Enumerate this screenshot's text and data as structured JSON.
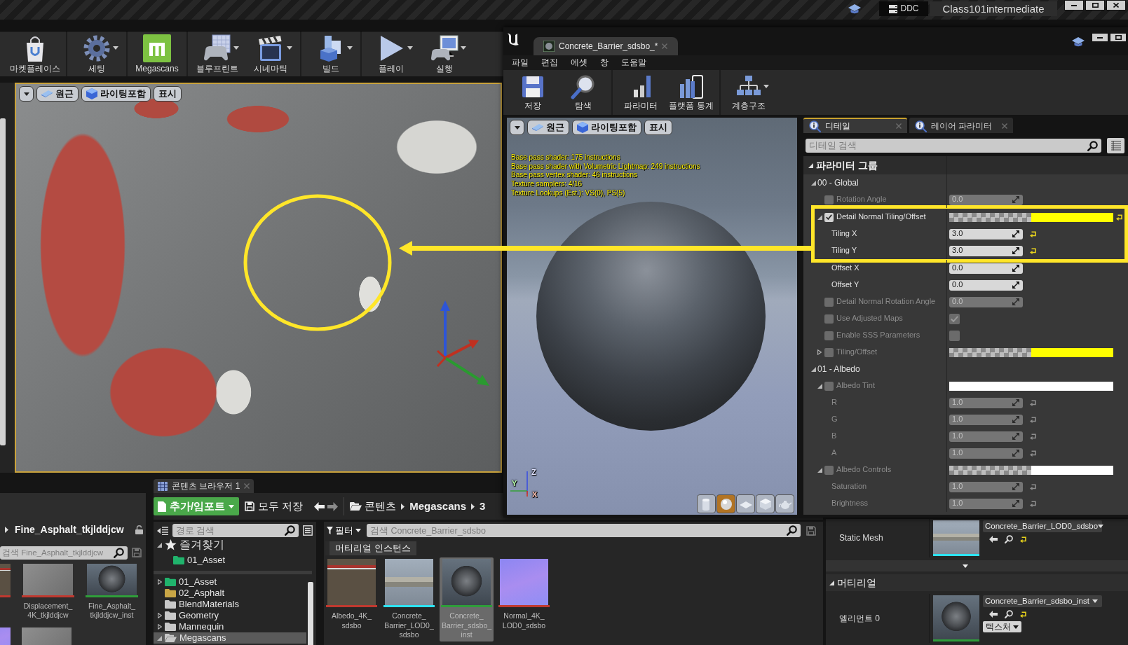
{
  "title_bar": {
    "buttons": [
      {
        "label": "DDC",
        "kind": "ddc"
      },
      {
        "label": "Class101intermediate",
        "kind": "project"
      }
    ]
  },
  "main_toolbar": [
    [
      {
        "label": "마켓플레이스",
        "dropdown": false
      }
    ],
    [
      {
        "label": "세팅",
        "dropdown": true
      }
    ],
    [
      {
        "label": "Megascans",
        "dropdown": false
      }
    ],
    [
      {
        "label": "블루프린트",
        "dropdown": true
      },
      {
        "label": "시네마틱",
        "dropdown": true
      }
    ],
    [
      {
        "label": "빌드",
        "dropdown": true
      }
    ],
    [
      {
        "label": "플레이",
        "dropdown": true
      },
      {
        "label": "실행",
        "dropdown": true
      }
    ]
  ],
  "level_viewport": {
    "toolbar": [
      "원근",
      "라이팅포함",
      "표시"
    ]
  },
  "material_editor": {
    "tab": "Concrete_Barrier_sdsbo_*",
    "menu": [
      "파일",
      "편집",
      "에셋",
      "창",
      "도움말"
    ],
    "toolbar": [
      [
        {
          "label": "저장",
          "dropdown": false
        },
        {
          "label": "탐색",
          "dropdown": false
        }
      ],
      [
        {
          "label": "파라미터",
          "dropdown": false
        },
        {
          "label": "플랫폼 통계",
          "dropdown": false
        }
      ],
      [
        {
          "label": "계층구조",
          "dropdown": true
        }
      ]
    ],
    "preview": {
      "toolbar": [
        "원근",
        "라이팅포함",
        "표시"
      ],
      "stats": [
        "Base pass shader: 175 instructions",
        "Base pass shader with Volumetric Lightmap: 249 instructions",
        "Base pass vertex shader: 46 instructions",
        "Texture samplers: 4/16",
        "Texture Lookups (Est.): VS(0), PS(5)"
      ],
      "axes": [
        "Z",
        "Y",
        "X"
      ],
      "shape_buttons": [
        {
          "selected": false
        },
        {
          "selected": true
        },
        {
          "selected": false
        },
        {
          "selected": false
        },
        {
          "selected": false
        }
      ]
    },
    "details": {
      "tabs": [
        {
          "label": "디테일",
          "selected": true
        },
        {
          "label": "레이어 파라미터",
          "selected": false
        }
      ],
      "search": {
        "placeholder": "디테일 검색"
      },
      "category": {
        "label": "파라미터 그룹",
        "expanded": true
      },
      "groups": [
        {
          "label": "00 - Global",
          "expanded": true,
          "children": [
            {
              "label": "Rotation Angle",
              "kind": "scalar",
              "override": false,
              "value": "0.0",
              "reset": false,
              "highlighted": false
            },
            {
              "label": "Detail Normal Tiling/Offset",
              "kind": "vector",
              "override": true,
              "expanded": true,
              "color": "#ffff00",
              "checker": true,
              "reset": true,
              "highlighted": true,
              "children": [
                {
                  "label": "Tiling X",
                  "value": "3.0",
                  "reset": true,
                  "highlighted": true
                },
                {
                  "label": "Tiling Y",
                  "value": "3.0",
                  "reset": true,
                  "highlighted": true
                },
                {
                  "label": "Offset X",
                  "value": "0.0",
                  "reset": false,
                  "highlighted": false
                },
                {
                  "label": "Offset Y",
                  "value": "0.0",
                  "reset": false,
                  "highlighted": false
                }
              ]
            },
            {
              "label": "Detail Normal Rotation Angle",
              "kind": "scalar",
              "override": false,
              "value": "0.0",
              "reset": false,
              "highlighted": false
            },
            {
              "label": "Use Adjusted Maps",
              "kind": "bool",
              "override": false,
              "checked": true,
              "highlighted": false
            },
            {
              "label": "Enable SSS Parameters",
              "kind": "bool",
              "override": false,
              "checked": false,
              "highlighted": false
            },
            {
              "label": "Tiling/Offset",
              "kind": "vector",
              "override": false,
              "expanded": false,
              "color": "#ffff00",
              "checker": true,
              "reset": false,
              "highlighted": false
            }
          ]
        },
        {
          "label": "01 - Albedo",
          "expanded": true,
          "children": [
            {
              "label": "Albedo Tint",
              "kind": "vector",
              "override": false,
              "expanded": true,
              "color": "#ffffff",
              "checker": false,
              "reset": false,
              "highlighted": false,
              "children": [
                {
                  "label": "R",
                  "value": "1.0",
                  "reset": true,
                  "highlighted": false
                },
                {
                  "label": "G",
                  "value": "1.0",
                  "reset": true,
                  "highlighted": false
                },
                {
                  "label": "B",
                  "value": "1.0",
                  "reset": true,
                  "highlighted": false
                },
                {
                  "label": "A",
                  "value": "1.0",
                  "reset": true,
                  "highlighted": false
                }
              ]
            },
            {
              "label": "Albedo Controls",
              "kind": "vector",
              "override": false,
              "expanded": true,
              "color": "#ffffff",
              "checker": true,
              "reset": false,
              "highlighted": false,
              "children": [
                {
                  "label": "Saturation",
                  "value": "1.0",
                  "reset": true,
                  "highlighted": false
                },
                {
                  "label": "Brightness",
                  "value": "1.0",
                  "reset": true,
                  "highlighted": false
                }
              ]
            }
          ]
        }
      ]
    }
  },
  "side_browser": {
    "path": "Fine_Asphalt_tkjlddjcw",
    "search": {
      "placeholder": "검색 Fine_Asphalt_tkjlddjcw"
    },
    "items": [
      {
        "kind": "albedo",
        "color": "#c0392f",
        "selected": false
      },
      {
        "label": "Displacement_4K_tkjlddjcw",
        "kind": "displacement",
        "color": "#c0392f",
        "selected": false
      },
      {
        "label": "Fine_Asphalt_tkjlddjcw_inst",
        "kind": "material",
        "color": "#2f9e3a",
        "selected": false
      },
      {
        "kind": "normal",
        "selected": false
      },
      {
        "kind": "displacement",
        "selected": false
      }
    ]
  },
  "content_browser": {
    "tab": "콘텐츠 브라우저 1",
    "add_button": "추가/임포트",
    "save_all": "모두 저장",
    "path": [
      "콘텐츠",
      "Megascans",
      "3"
    ],
    "sources": {
      "search": {
        "placeholder": "경로 검색"
      },
      "favorites": {
        "label": "즐겨찾기",
        "expanded": true,
        "children": [
          {
            "label": "01_Asset",
            "color": "#20b36c",
            "has_children": false,
            "expanded": false,
            "selected": false
          }
        ]
      },
      "folders": [
        {
          "label": "01_Asset",
          "color": "#20b36c",
          "has_children": true,
          "expanded": false,
          "selected": false
        },
        {
          "label": "02_Asphalt",
          "color": "#c9a646",
          "has_children": false,
          "expanded": false,
          "selected": false
        },
        {
          "label": "BlendMaterials",
          "color": "#c8c8c8",
          "has_children": false,
          "expanded": false,
          "selected": false
        },
        {
          "label": "Geometry",
          "color": "#c8c8c8",
          "has_children": true,
          "expanded": false,
          "selected": false
        },
        {
          "label": "Mannequin",
          "color": "#c8c8c8",
          "has_children": true,
          "expanded": false,
          "selected": false
        },
        {
          "label": "Megascans",
          "color": "#c8c8c8",
          "has_children": true,
          "expanded": true,
          "selected": true
        }
      ]
    },
    "assets": {
      "filter": "필터",
      "search": {
        "placeholder": "검색 Concrete_Barrier_sdsbo"
      },
      "chips": [
        "머티리얼 인스턴스"
      ],
      "items": [
        {
          "label": "Albedo_4K_sdsbo",
          "kind": "albedo",
          "color": "#c0392f",
          "selected": false
        },
        {
          "label": "Concrete_Barrier_LOD0_sdsbo",
          "kind": "mesh",
          "color": "#2de3f2",
          "selected": false
        },
        {
          "label": "Concrete_Barrier_sdsbo_inst",
          "kind": "material",
          "color": "#2f9e3a",
          "selected": true
        },
        {
          "label": "Normal_4K_LOD0_sdsbo",
          "kind": "normal",
          "color": "#c0392f",
          "selected": false
        }
      ]
    }
  },
  "mesh_details": {
    "rows": [
      {
        "label": "Static Mesh",
        "asset": "Concrete_Barrier_LOD0_sdsbo",
        "kind": "mesh",
        "color": "#2de3f2",
        "reset": true
      }
    ],
    "category": {
      "label": "머티리얼",
      "expanded": true
    },
    "materials": [
      {
        "label": "엘리먼트 0",
        "asset": "Concrete_Barrier_sdsbo_inst",
        "kind": "material",
        "color": "#2f9e3a",
        "reset": true,
        "button": "텍스처"
      }
    ]
  }
}
